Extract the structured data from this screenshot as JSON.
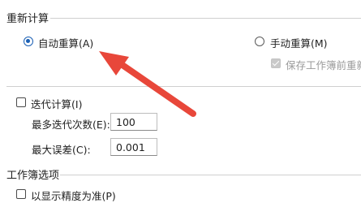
{
  "recalc_section": {
    "title": "重新计算",
    "auto_label": "自动重算(A)",
    "manual_label": "手动重算(M)",
    "save_recalc_label": "保存工作簿前重新计",
    "auto_selected": true,
    "save_recalc_checked": true
  },
  "iteration": {
    "enable_label": "迭代计算(I)",
    "enable_checked": false,
    "max_iter_label": "最多迭代次数(E):",
    "max_iter_value": "100",
    "max_change_label": "最大误差(C):",
    "max_change_value": "0.001"
  },
  "workbook_section": {
    "title": "工作簿选项",
    "precision_label": "以显示精度为准(P)",
    "precision_checked": false
  },
  "annotation": {
    "arrow_color": "#e8473a"
  }
}
